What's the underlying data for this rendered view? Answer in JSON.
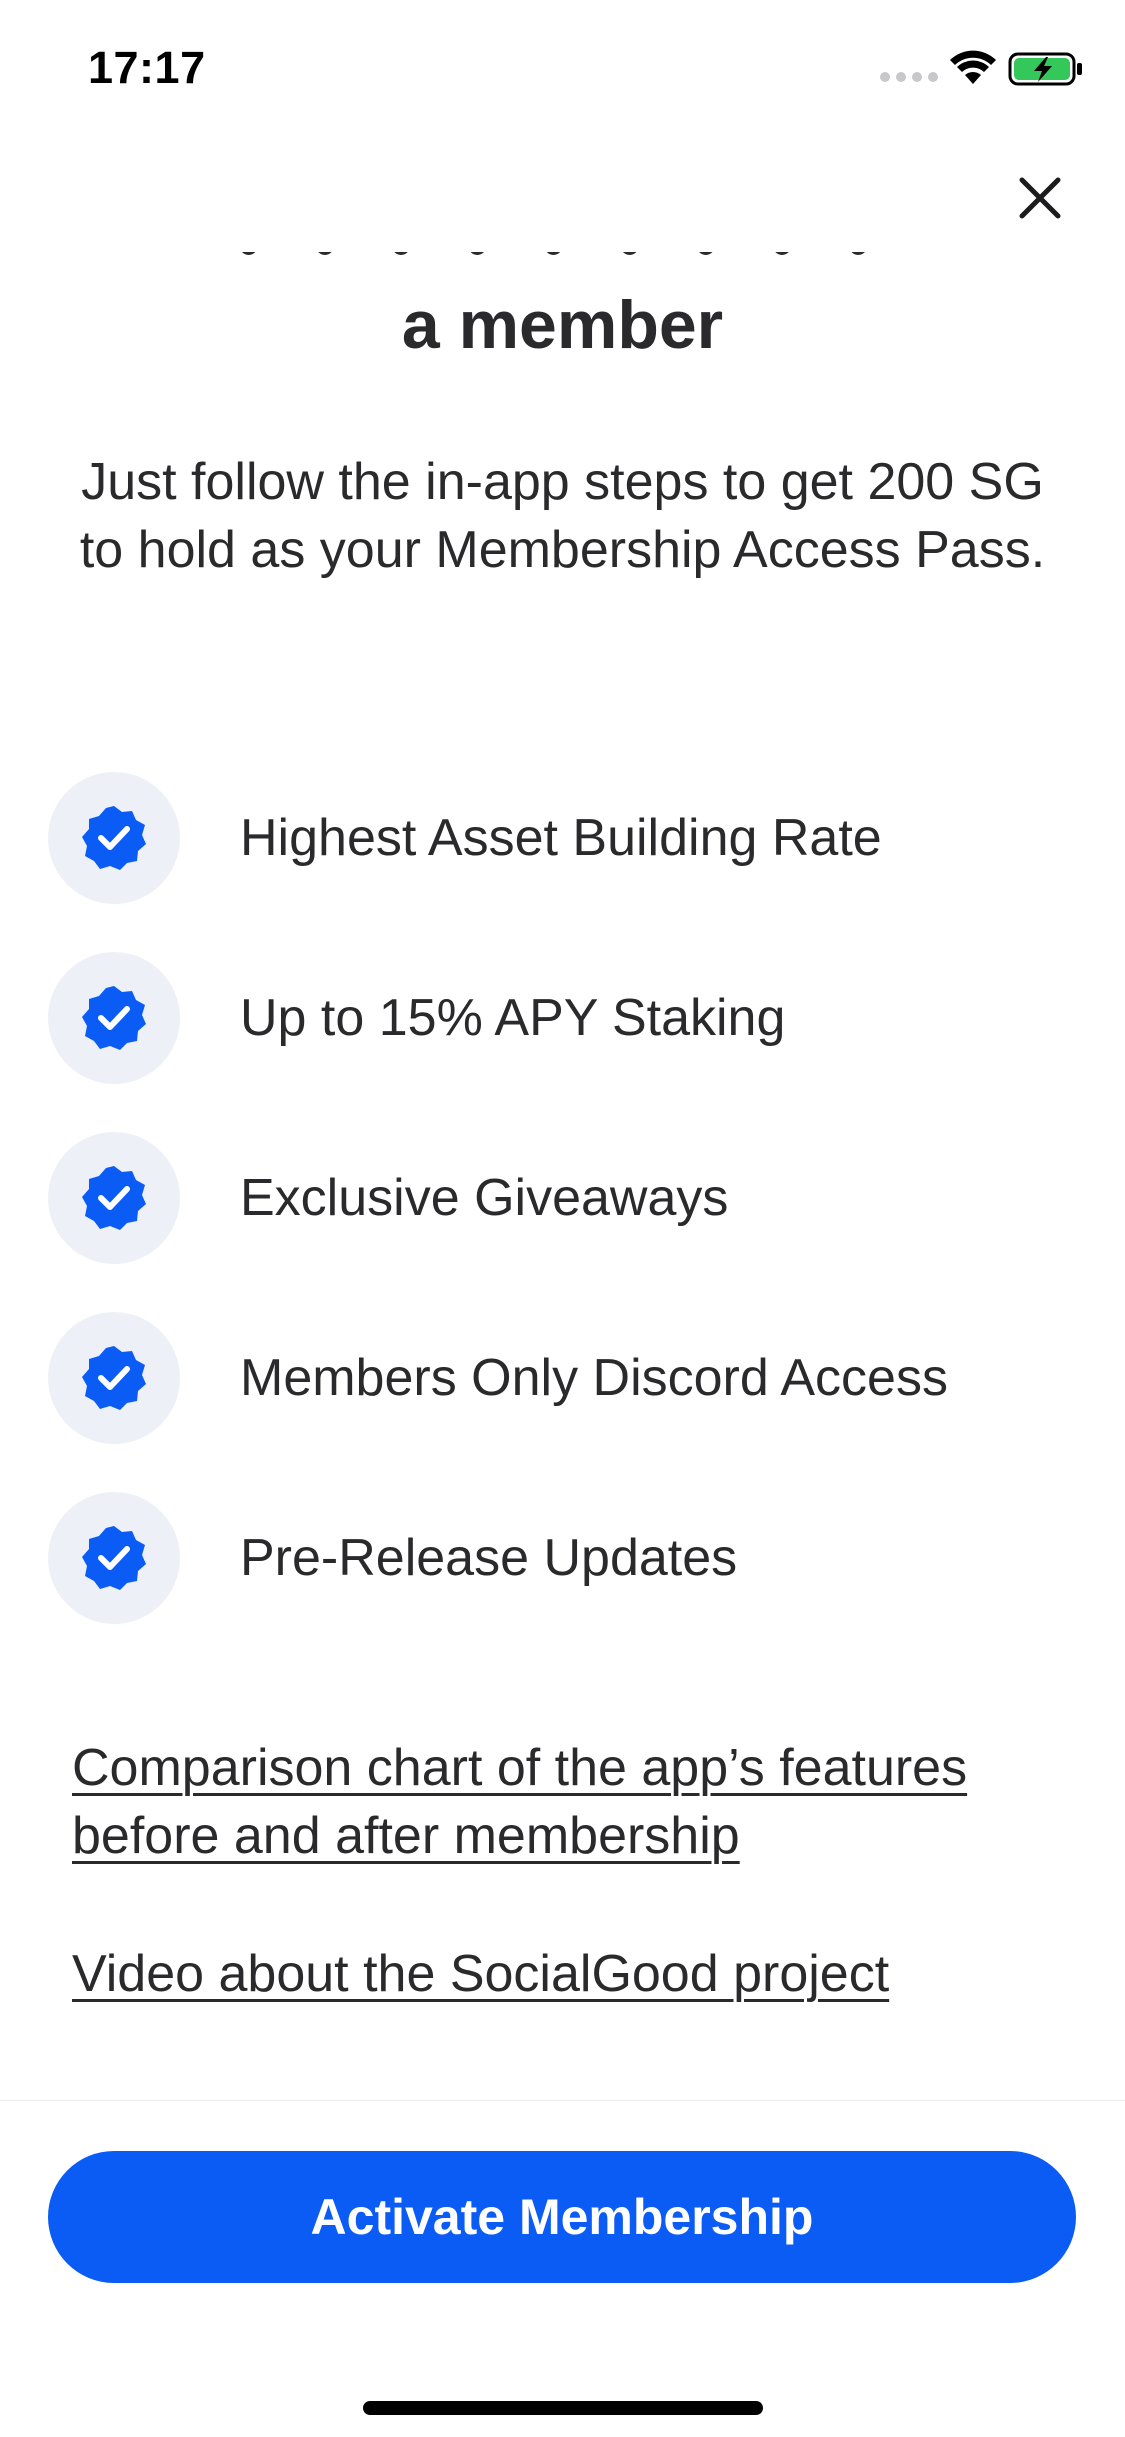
{
  "status_bar": {
    "time": "17:17"
  },
  "header": {
    "close_icon": "close-icon",
    "title": "a member",
    "subtitle": "Just follow the in-app steps to get 200 SG to hold as your Membership Access Pass."
  },
  "benefits": {
    "icon": "checkmark-badge-icon",
    "items": [
      {
        "label": "Highest Asset Building Rate"
      },
      {
        "label": "Up to 15% APY Staking"
      },
      {
        "label": "Exclusive Giveaways"
      },
      {
        "label": "Members Only Discord Access"
      },
      {
        "label": "Pre-Release Updates"
      }
    ]
  },
  "links": {
    "comparison": "Comparison chart of the app’s features before and after membership",
    "video": "Video about the SocialGood project"
  },
  "footer": {
    "activate_label": "Activate Membership"
  },
  "colors": {
    "accent": "#0a5cf5",
    "badge_bg": "#eef0f7",
    "text": "#2a2a2c",
    "battery_fill": "#34c759"
  }
}
